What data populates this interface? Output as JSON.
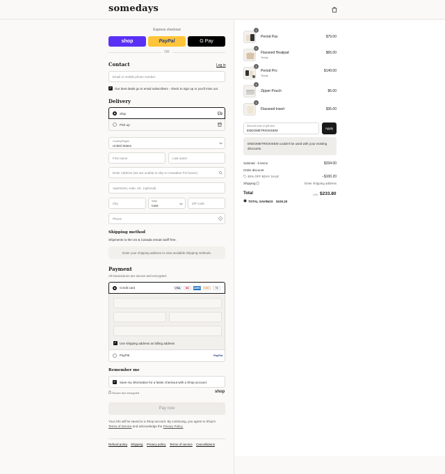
{
  "brand": {
    "logo": "somedays"
  },
  "express": {
    "label": "Express checkout",
    "shop": "shop",
    "paypal": "PayPal",
    "gpay": "G Pay",
    "or": "OR"
  },
  "contact": {
    "heading": "Contact",
    "login": "Log in",
    "email_placeholder": "Email or mobile phone number",
    "subscribe_label": "Our best deals go to email subscribers - check to sign up or you'll miss out"
  },
  "delivery": {
    "heading": "Delivery",
    "ship": "Ship",
    "pickup": "Pick up",
    "country_label": "Country/Region",
    "country_value": "United States",
    "first_name": "First name",
    "last_name": "Last name",
    "address": "Enter Address (we are unable to ship to Canadian PO boxes)",
    "apartment": "Apartment, suite, etc. (optional)",
    "city": "City",
    "state_label": "State",
    "state_value": "Iowa",
    "zip": "ZIP code",
    "phone": "Phone"
  },
  "shipping_method": {
    "heading": "Shipping method",
    "note": "Shipments to the US & Canada remain tariff free.",
    "placeholder": "Enter your shipping address to view available shipping methods."
  },
  "payment": {
    "heading": "Payment",
    "note": "All transactions are secure and encrypted.",
    "credit_card": "Credit card",
    "card_logos": [
      "VISA",
      "MC",
      "AMEX",
      "DISC"
    ],
    "more_cards": "+3",
    "billing_label": "Use shipping address as billing address",
    "paypal": "PayPal",
    "paypal_logo": "PayPal"
  },
  "remember": {
    "heading": "Remember me",
    "label": "Save my information for a faster checkout with a Shop account",
    "secure": "Secure and encrypted",
    "shop_logo": "shop"
  },
  "pay_now": "Pay now",
  "legal": {
    "text": "Your info will be saved to a Shop account. By continuing, you agree to Shop's",
    "terms": "Terms of Service",
    "and": "and acknowledge the",
    "privacy": "Privacy Policy."
  },
  "footer_links": [
    "Refund policy",
    "Shipping",
    "Privacy policy",
    "Terms of service",
    "Cancellations"
  ],
  "cart": {
    "items": [
      {
        "name": "Period Pas",
        "variant": "",
        "price": "$79.00",
        "qty": "1"
      },
      {
        "name": "Flaxseed Heatpad",
        "variant": "Teddy",
        "price": "$65.00",
        "qty": "1"
      },
      {
        "name": "Period Pro",
        "variant": "Teddy",
        "price": "$149.00",
        "qty": "1"
      },
      {
        "name": "Zipper Pouch",
        "variant": "",
        "price": "$6.00",
        "qty": "1"
      },
      {
        "name": "Flaxseed Insert",
        "variant": "",
        "price": "$35.00",
        "qty": "1"
      }
    ],
    "discount_label": "Discount code or gift card",
    "discount_value": "ENDOMETRIOSISEM",
    "apply": "Apply",
    "error": "ENDOMETRIOSISEM couldn't be used with your existing discounts.",
    "subtotal_label": "Subtotal · 5 items",
    "subtotal_value": "$334.00",
    "order_discount": "Order discount",
    "discount_code": "30% OFF BDAY SALE",
    "discount_amount": "−$100.20",
    "shipping_label": "Shipping",
    "shipping_value": "Enter shipping address",
    "total_label": "Total",
    "currency": "USD",
    "total_value": "$233.80",
    "savings_label": "TOTAL SAVINGS",
    "savings_value": "$100.20"
  }
}
